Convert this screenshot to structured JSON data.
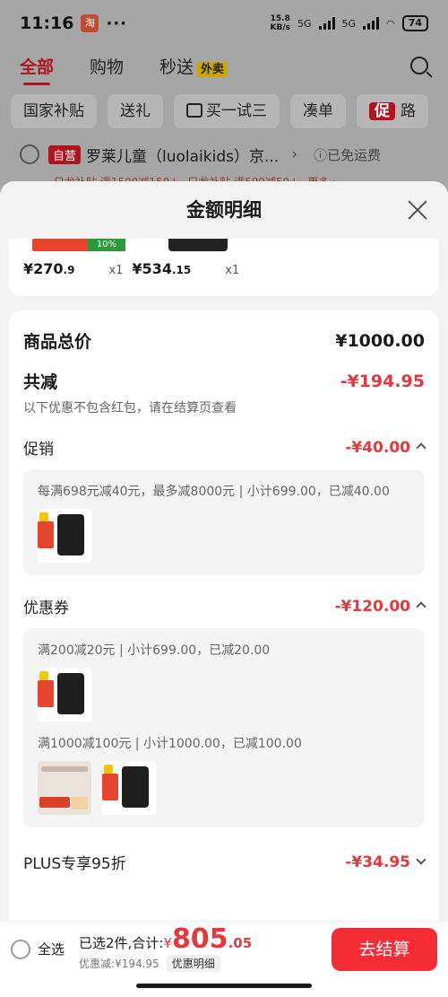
{
  "status": {
    "time": "11:16",
    "app_icon": "淘",
    "dots": "···",
    "net_speed_top": "15.8",
    "net_speed_unit": "KB/s",
    "sig1": "5G",
    "sig2": "5G",
    "battery": "74"
  },
  "tabs": {
    "all": "全部",
    "shop": "购物",
    "flash": "秒送",
    "takeout": "外卖"
  },
  "chips": [
    "国家补贴",
    "送礼",
    "买一试三",
    "凑单",
    "路"
  ],
  "chip_promo_badge": "促",
  "store": {
    "self_tag": "自营",
    "name": "罗莱儿童（luolaikids）京...",
    "arrow": "›",
    "shipping": "ⓘ已免运费"
  },
  "bg_promos": [
    "只龙补贴 满1500减150↓",
    "只龙补贴 满599减50↓",
    "更多 ›"
  ],
  "sheet": {
    "title": "金额明细",
    "items": [
      {
        "price_main": "¥270",
        "price_dec": ".9",
        "qty": "x1",
        "badge": "10%"
      },
      {
        "price_main": "¥534",
        "price_dec": ".15",
        "qty": "x1"
      }
    ],
    "total_label": "商品总价",
    "total_value": "¥1000.00",
    "reduce_label": "共减",
    "reduce_value": "-¥194.95",
    "reduce_note": "以下优惠不包含红包，请在结算页查看",
    "promo": {
      "label": "促销",
      "value": "-¥40.00",
      "desc": "每满698元减40元，最多减8000元 | 小计699.00，已减40.00"
    },
    "coupon": {
      "label": "优惠券",
      "value": "-¥120.00",
      "desc1": "满200减20元 | 小计699.00，已减20.00",
      "desc2": "满1000减100元 | 小计1000.00，已减100.00"
    },
    "plus": {
      "label": "PLUS专享95折",
      "value": "-¥34.95"
    }
  },
  "checkout": {
    "select_all": "全选",
    "selected": "已选2件,合计:",
    "currency": "¥",
    "amount_int": "805",
    "amount_dec": ".05",
    "discount": "优惠减:¥194.95",
    "detail_button": "优惠明细",
    "go": "去结算"
  },
  "colors": {
    "accent": "#e4393c",
    "button": "#f42c36"
  }
}
